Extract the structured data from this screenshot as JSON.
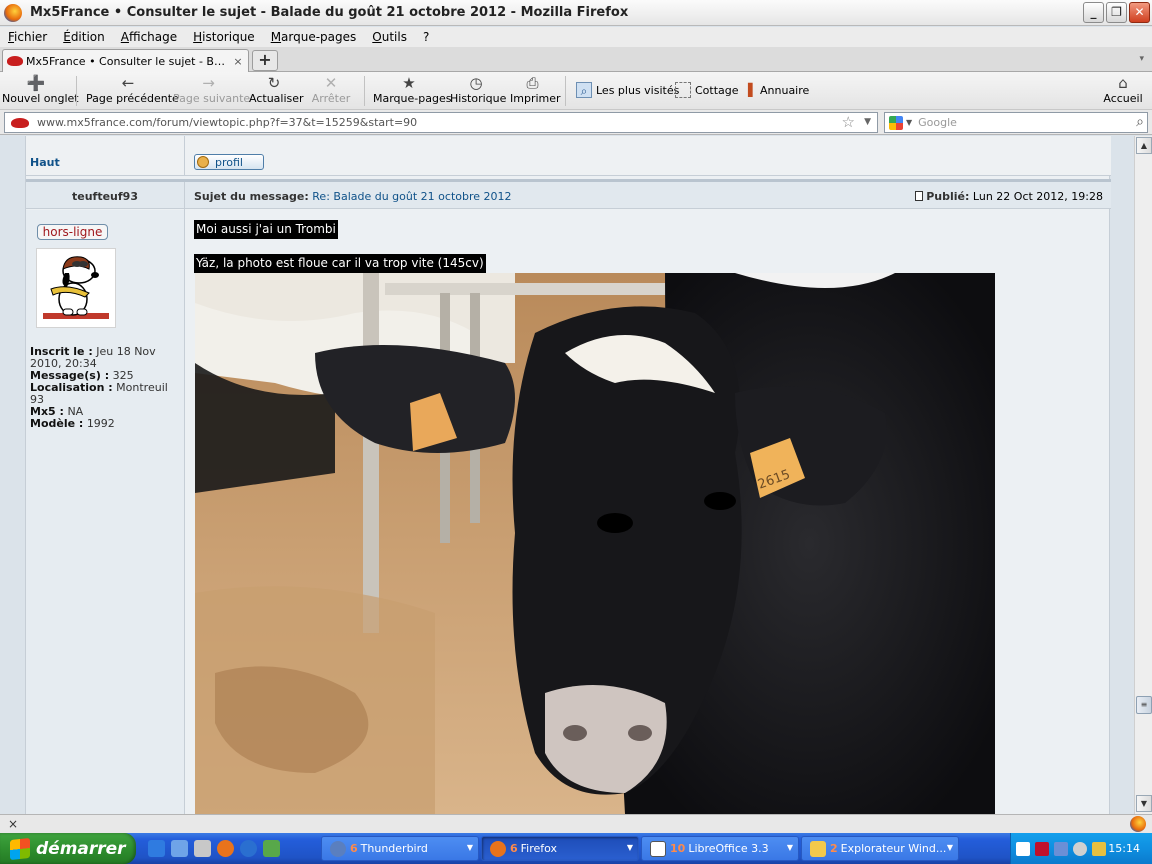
{
  "window": {
    "title": "Mx5France • Consulter le sujet - Balade du goût 21 octobre 2012 - Mozilla Firefox",
    "min": "_",
    "max": "❐",
    "close": "✕"
  },
  "menu": [
    "Fichier",
    "Édition",
    "Affichage",
    "Historique",
    "Marque-pages",
    "Outils",
    "?"
  ],
  "tab": {
    "label": "Mx5France • Consulter le sujet - Balade du g...",
    "close": "×",
    "new": "+",
    "list": "▾"
  },
  "toolbar": {
    "new_tab": "Nouvel onglet",
    "back": "Page précédente",
    "forward": "Page suivante",
    "reload": "Actualiser",
    "stop": "Arrêter",
    "bookmarks": "Marque-pages",
    "history": "Historique",
    "print": "Imprimer",
    "home": "Accueil",
    "bm_most_visited": "Les plus visités",
    "bm_cottage": "Cottage",
    "bm_annuaire": "Annuaire"
  },
  "address": {
    "host": "www.mx5france.com",
    "path": "/forum/viewtopic.php?f=37&t=15259&start=90",
    "search_placeholder": "Google"
  },
  "forum": {
    "top_link": "Haut",
    "profile_button": "profil",
    "post": {
      "author": "teufteuf93",
      "subject_label": "Sujet du message:",
      "subject": "Re: Balade du goût 21 octobre 2012",
      "posted_label": "Publié:",
      "posted": "Lun 22 Oct 2012, 19:28",
      "status": "hors-ligne",
      "registered_label": "Inscrit le :",
      "registered": "Jeu 18 Nov 2010, 20:34",
      "messages_label": "Message(s) :",
      "messages": "325",
      "location_label": "Localisation :",
      "location": "Montreuil 93",
      "mx5_label": "Mx5 :",
      "mx5": "NA",
      "model_label": "Modèle :",
      "model": "1992",
      "line1": "Moi aussi j'ai un Trombi",
      "line2": "Yäz, la photo est floue car il va trop vite (145cv)",
      "ear_tag": "2615"
    }
  },
  "statusbar": {
    "close": "×"
  },
  "taskbar": {
    "start": "démarrer",
    "tasks": [
      {
        "count": "6",
        "label": "Thunderbird"
      },
      {
        "count": "6",
        "label": "Firefox"
      },
      {
        "count": "10",
        "label": "LibreOffice 3.3"
      },
      {
        "count": "2",
        "label": "Explorateur Wind..."
      }
    ],
    "clock": "15:14"
  }
}
